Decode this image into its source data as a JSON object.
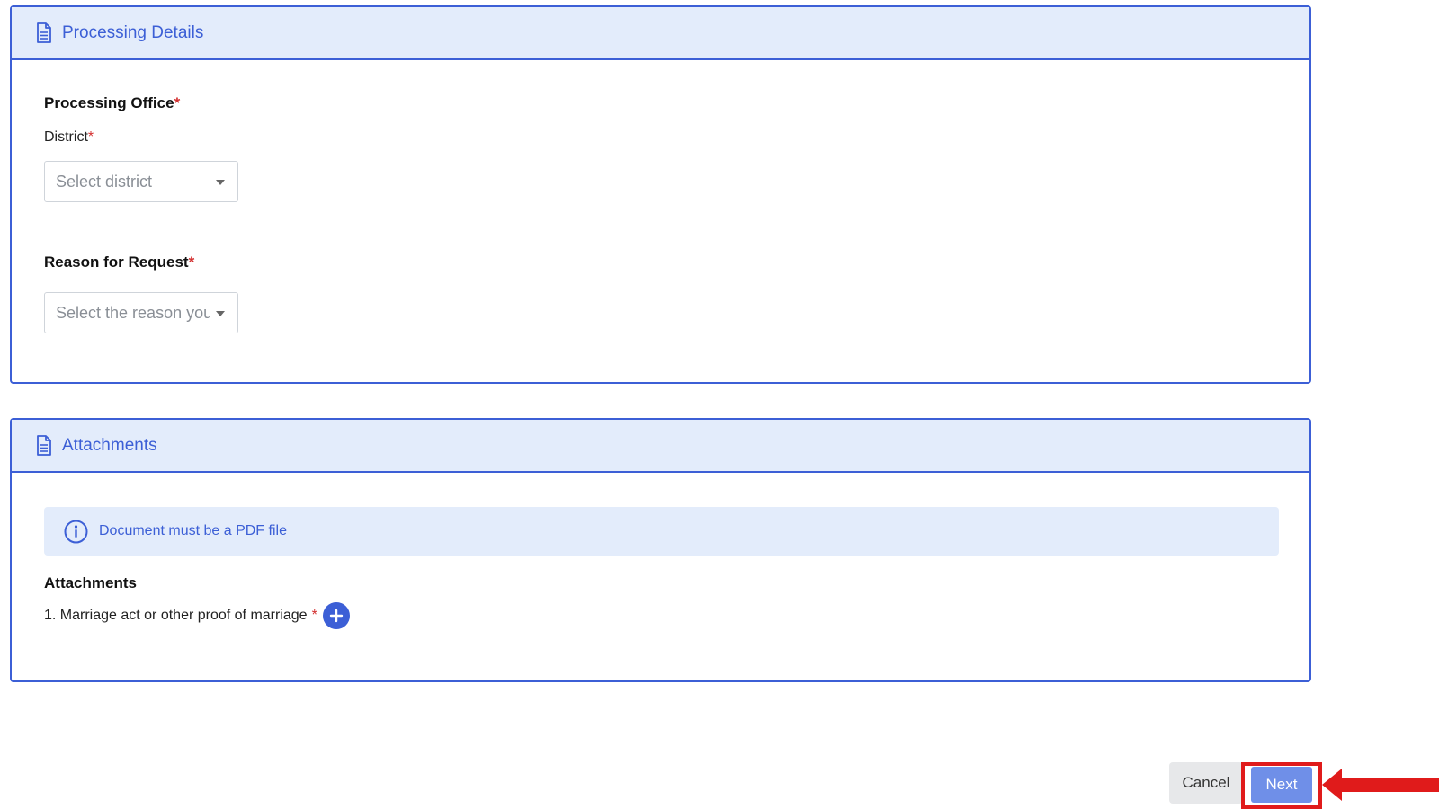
{
  "processing_details": {
    "title": "Processing Details",
    "processing_office_label": "Processing Office",
    "district_label": "District",
    "district_placeholder": "Select district",
    "reason_label": "Reason for Request",
    "reason_placeholder": "Select the reason you"
  },
  "attachments_section": {
    "title": "Attachments",
    "info_text": "Document must be a PDF file",
    "subheading": "Attachments",
    "items": [
      {
        "label": "1. Marriage act or other proof of marriage"
      }
    ]
  },
  "required_marker": "*",
  "footer": {
    "cancel_label": "Cancel",
    "next_label": "Next"
  },
  "colors": {
    "accent": "#3c5fd6",
    "header_bg": "#e3ecfb",
    "required": "#d32f2f",
    "highlight": "#e01b1b",
    "next_button": "#6f8fe8"
  },
  "icons": {
    "section_header": "document-icon",
    "info": "info-circle-icon",
    "add": "plus-icon",
    "select_caret": "caret-down-icon",
    "annotation": "arrow-left-icon"
  }
}
